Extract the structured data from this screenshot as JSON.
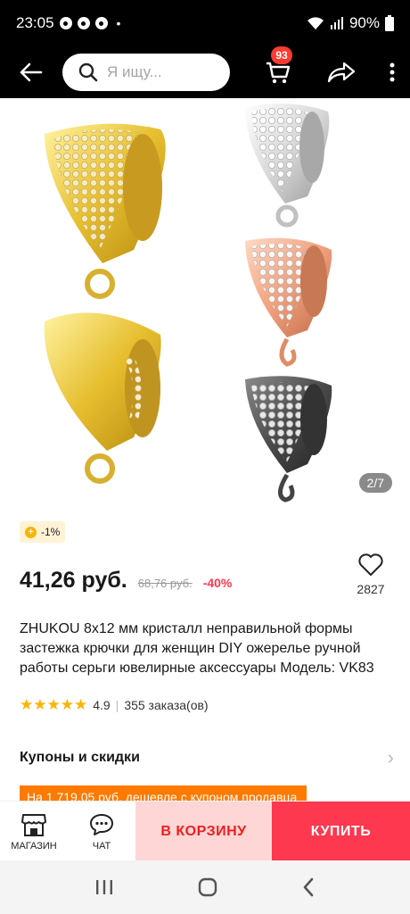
{
  "status_bar": {
    "time": "23:05",
    "bullet": "•",
    "battery": "90%"
  },
  "header": {
    "search_placeholder": "Я ищу...",
    "cart_count": "93"
  },
  "gallery": {
    "counter": "2/7"
  },
  "discount_chip": {
    "label": "-1%"
  },
  "price": {
    "current": "41,26 руб.",
    "old": "68,76 руб.",
    "discount": "-40%"
  },
  "wishlist": {
    "count": "2827"
  },
  "product": {
    "title": "ZHUKOU 8x12 мм кристалл неправильной формы застежка крючки для женщин DIY ожерелье ручной работы серьги ювелирные аксессуары Модель: VK83",
    "rating": "4.9",
    "orders": "355 заказа(ов)",
    "stars": "★★★★★"
  },
  "coupons": {
    "label": "Купоны и скидки",
    "chevron": "›",
    "promo": "На 1 719,05 руб. дешевле с купоном продавца"
  },
  "bottom_bar": {
    "store_label": "МАГАЗИН",
    "chat_label": "ЧАТ",
    "cart_label": "В КОРЗИНУ",
    "buy_label": "КУПИТЬ"
  },
  "icons": {
    "status": [
      "chrome-icon",
      "chrome-icon",
      "chrome-icon",
      "wifi-icon",
      "signal-icon",
      "battery-icon"
    ],
    "nav": [
      "recents-icon",
      "home-icon",
      "back-nav-icon"
    ]
  },
  "colors": {
    "accent_red": "#fd384f",
    "cart_bg": "#ffd6d6",
    "promo_orange": "#ff7a00",
    "star": "#ffb300"
  }
}
